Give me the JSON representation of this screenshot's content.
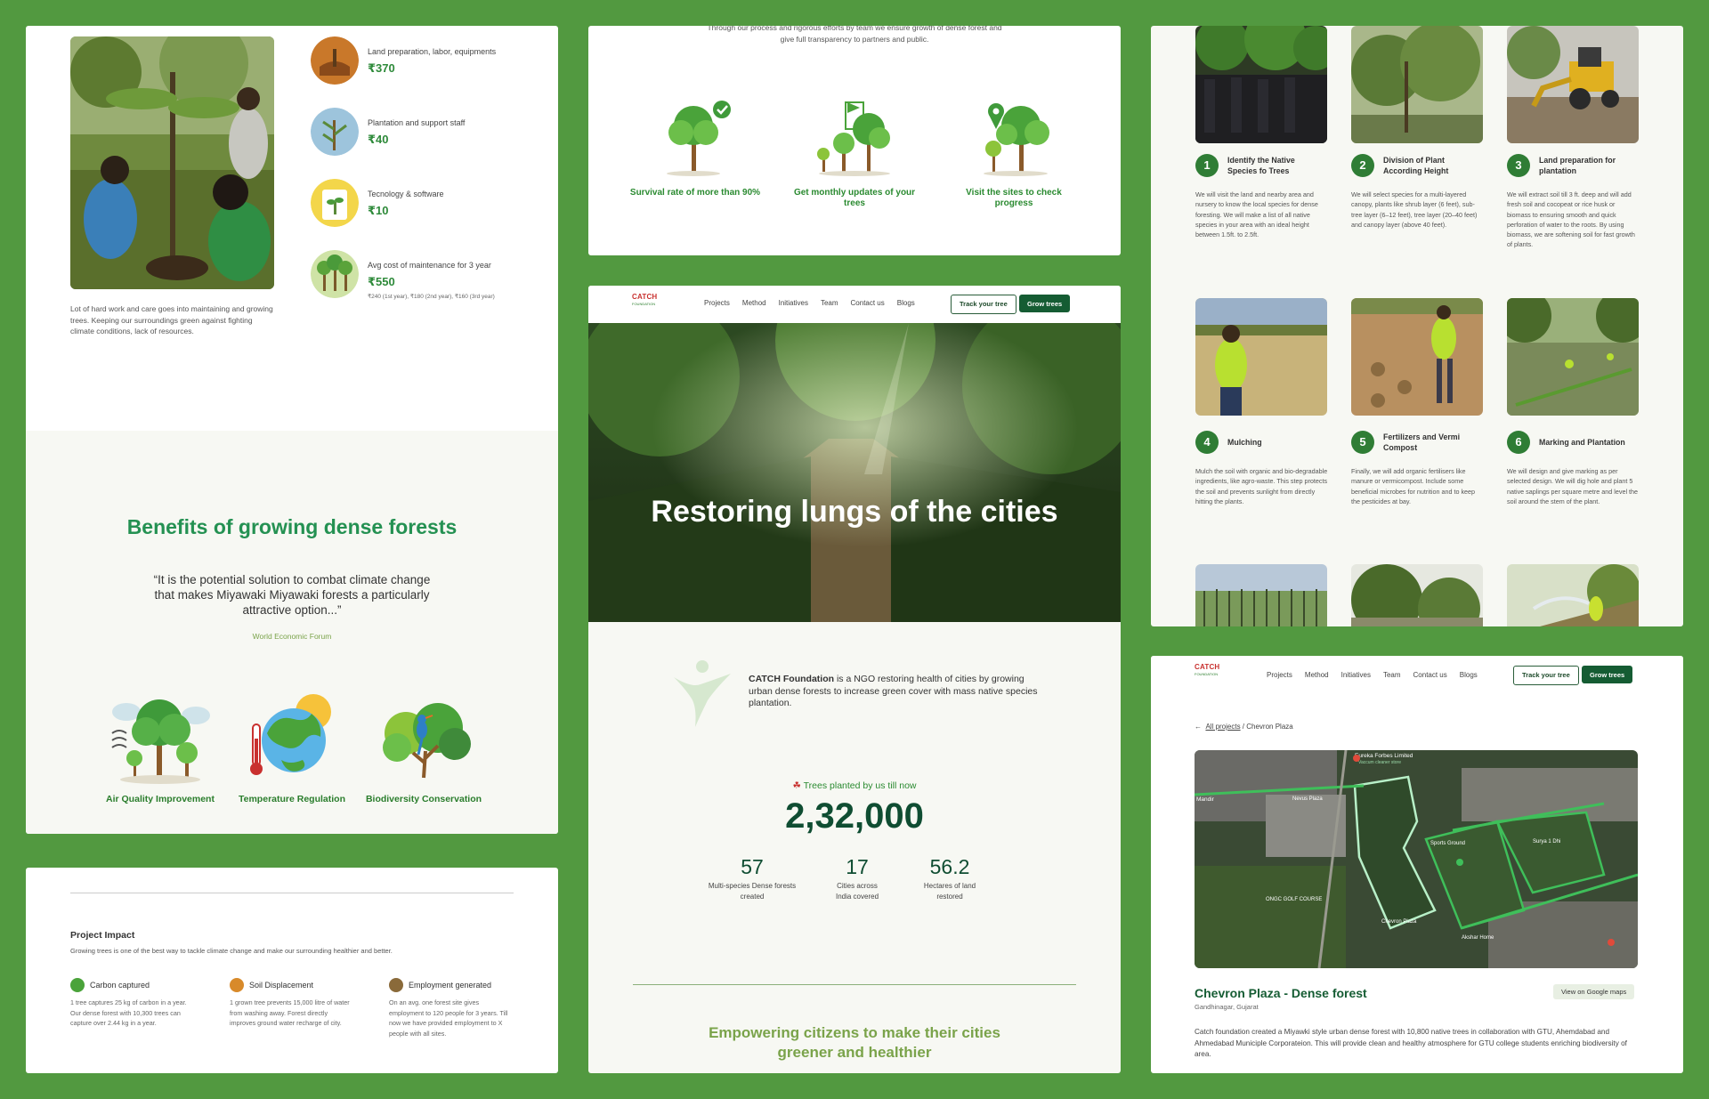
{
  "colors": {
    "page_bg": "#529940",
    "brand_green": "#249152",
    "dark_green": "#155c33",
    "accent_olive": "#7aa34a",
    "logo_red": "#c8302e"
  },
  "cost_panel": {
    "rows": [
      {
        "label": "Land preparation, labor, equipments",
        "value": "₹370",
        "icon": "soil-icon"
      },
      {
        "label": "Plantation and support staff",
        "value": "₹40",
        "icon": "sapling-icon"
      },
      {
        "label": "Tecnology & software",
        "value": "₹10",
        "icon": "tech-icon"
      },
      {
        "label": "Avg cost of maintenance for 3 year",
        "value": "₹550",
        "note": "₹240 (1st year), ₹180 (2nd year), ₹160 (3rd year)",
        "icon": "forest-icon"
      }
    ],
    "caption": "Lot of hard work and care goes into maintaining and growing trees. Keeping our surroundings green against fighting climate conditions, lack of resources."
  },
  "benefits": {
    "title": "Benefits of growing dense forests",
    "quote": "“It is the potential solution to combat climate change that makes Miyawaki Miyawaki forests a particularly attractive option...”",
    "quote_source": "World Economic Forum",
    "items": [
      {
        "label": "Air Quality Improvement",
        "icon": "air-quality-icon"
      },
      {
        "label": "Temperature Regulation",
        "icon": "temperature-icon"
      },
      {
        "label": "Biodiversity Conservation",
        "icon": "biodiversity-icon"
      }
    ]
  },
  "impact": {
    "title": "Project Impact",
    "subtitle": "Growing trees is one of the best way to tackle climate change and make our surrounding healthier and better.",
    "items": [
      {
        "title": "Carbon captured",
        "text": "1 tree captures 25 kg of carbon in a year. Our dense forest with 10,300 trees can capture over 2.44 kg in a year.",
        "icon": "carbon-icon"
      },
      {
        "title": "Soil Displacement",
        "text": "1 grown tree prevents 15,000 litre of water from washing away. Forest directly improves ground water recharge of city.",
        "icon": "soil-icon"
      },
      {
        "title": "Employment generated",
        "text": "On an avg. one forest site gives employment to 120 people for 3 years. Till now we have provided employment to X people with all sites.",
        "icon": "employment-icon"
      }
    ]
  },
  "features": {
    "intro": "Through our process and rigorous efforts by team we ensure growth of dense forest and give full transparency to partners and public.",
    "items": [
      {
        "label": "Survival rate of more than 90%",
        "icon": "survival-tree-icon"
      },
      {
        "label": "Get monthly updates of your trees",
        "icon": "updates-tree-icon"
      },
      {
        "label": "Visit the sites to check progress",
        "icon": "location-tree-icon"
      }
    ]
  },
  "nav": {
    "logo_title": "CATCH",
    "logo_sub": "FOUNDATION",
    "links": [
      "Projects",
      "Method",
      "Initiatives",
      "Team",
      "Contact us",
      "Blogs"
    ],
    "track_label": "Track your tree",
    "grow_label": "Grow trees"
  },
  "home": {
    "hero_title": "Restoring lungs of the cities",
    "about_brand": "CATCH Foundation",
    "about_text": " is a NGO restoring health of cities by growing urban dense forests to increase green cover with mass native species plantation.",
    "trees_label": "Trees planted by us till now",
    "trees_count": "2,32,000",
    "stats": [
      {
        "value": "57",
        "label": "Multi-species Dense forests created"
      },
      {
        "value": "17",
        "label": "Cities across India covered"
      },
      {
        "value": "56.2",
        "label": "Hectares of land restored"
      }
    ],
    "empower": "Empowering citizens to make their cities greener and healthier"
  },
  "method": {
    "steps": [
      {
        "num": "1",
        "title": "Identify the Native Species fo Trees",
        "text": "We will visit the land and nearby area and nursery to know the local species for dense foresting. We will make a list of all native species in your area with an ideal height between 1.5ft. to 2.5ft."
      },
      {
        "num": "2",
        "title": "Division of Plant According Height",
        "text": "We will select species for a multi-layered canopy, plants like shrub layer (6 feet), sub-tree layer (6–12 feet), tree layer (20–40 feet) and canopy layer (above 40 feet)."
      },
      {
        "num": "3",
        "title": "Land preparation for plantation",
        "text": "We will extract soil till 3 ft. deep and will add fresh soil and cocopeat or rice husk or biomass to ensuring smooth and quick perforation of water to the roots. By using biomass, we are softening soil for fast growth of plants."
      },
      {
        "num": "4",
        "title": "Mulching",
        "text": "Mulch the soil with organic and bio-degradable ingredients, like agro-waste. This step protects the soil and prevents sunlight from directly hitting the plants."
      },
      {
        "num": "5",
        "title": "Fertilizers and Vermi Compost",
        "text": "Finally, we will add organic fertilisers like manure or vermicompost. Include some beneficial microbes for nutrition and to keep the pesticides at bay."
      },
      {
        "num": "6",
        "title": "Marking and Plantation",
        "text": "We will design and give marking as per selected design. We will dig hole and plant 5 native saplings per square metre and level the soil around the stem of the plant."
      }
    ]
  },
  "project": {
    "crumb_link": "All projects",
    "crumb_current": " / Chevron Plaza",
    "map_labels": [
      "Eureka Forbes Limited",
      "Vaccum cleaner store",
      "Mandir",
      "Nevus Plaza",
      "ONGC GOLF COURSE",
      "Akshar Home",
      "Surya 1 Dhi",
      "Sports Ground",
      "Chevron Plaza"
    ],
    "title": "Chevron Plaza - Dense forest",
    "location": "Gandhinagar, Gujarat",
    "map_button": "View on Google maps",
    "description": "Catch foundation created a Miyawki style urban dense forest with 10,800 native trees in collaboration with GTU, Ahemdabad and Ahmedabad Municiple Corporateion. This will provide clean and healthy atmosphere for GTU college students enriching biodiversity of area."
  }
}
